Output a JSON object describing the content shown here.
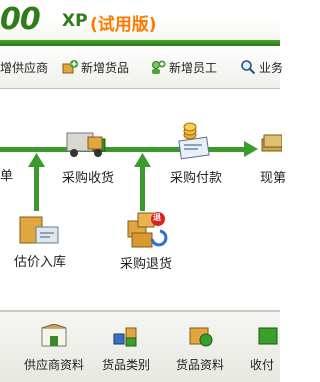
{
  "banner": {
    "brand_number": "00",
    "brand_xp": "XP",
    "brand_edition": "(试用版)"
  },
  "toolbar": {
    "items": [
      {
        "label": "增供应商",
        "icon": "supplier-icon"
      },
      {
        "label": "新增货品",
        "icon": "add-goods-icon"
      },
      {
        "label": "新增员工",
        "icon": "add-employee-icon"
      },
      {
        "label": "业务",
        "icon": "search-icon"
      }
    ]
  },
  "workflow": {
    "nodes": {
      "partial_left": "单",
      "purchase_receive": "采购收货",
      "purchase_payment": "采购付款",
      "partial_right": "现第",
      "estimate_stockin": "估价入库",
      "purchase_return": "采购退货"
    },
    "return_badge": "退"
  },
  "bottom": {
    "items": [
      {
        "label": "供应商资料",
        "icon": "supplier-info-icon"
      },
      {
        "label": "货品类别",
        "icon": "goods-category-icon"
      },
      {
        "label": "货品资料",
        "icon": "goods-info-icon"
      },
      {
        "label": "收付",
        "icon": "payment-icon"
      }
    ]
  },
  "colors": {
    "brand_green": "#2f7d1a",
    "trial_orange": "#ff7a00",
    "flow_green": "#3a9a2c"
  }
}
